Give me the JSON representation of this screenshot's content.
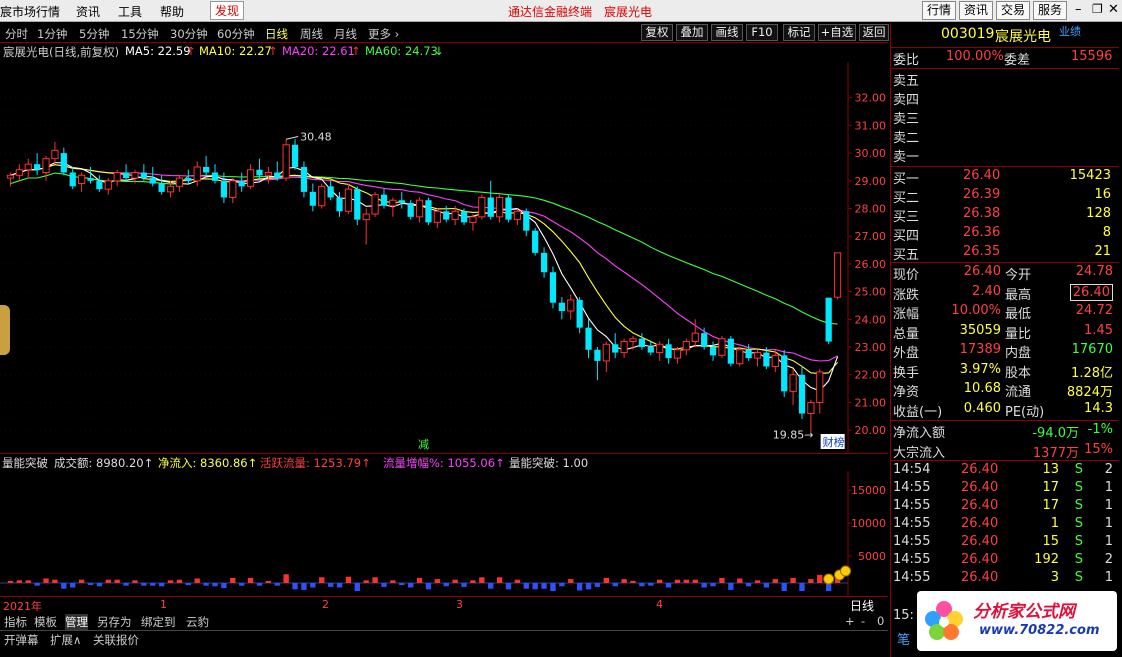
{
  "menubar": {
    "items": [
      "宸市场行情",
      "资讯",
      "工具",
      "帮助",
      "发现"
    ],
    "center_title": "通达信金融终端",
    "center_stock": "宸展光电",
    "right_buttons": [
      "行情",
      "资讯",
      "交易",
      "服务"
    ]
  },
  "toolbar": {
    "periods": [
      "分时",
      "1分钟",
      "5分钟",
      "15分钟",
      "30分钟",
      "60分钟",
      "日线",
      "周线",
      "月线",
      "更多 ›"
    ],
    "buttons": [
      "复权",
      "叠加",
      "画线",
      "F10",
      "标记",
      "+自选",
      "返回"
    ]
  },
  "main_chart": {
    "header": {
      "title": "宸展光电(日线,前复权)",
      "ma5": "MA5: 22.59",
      "ma10": "MA10: 22.27",
      "ma20": "MA20: 22.61",
      "ma60": "MA60: 24.73"
    },
    "high_label": "30.48",
    "low_label": "19.85→",
    "marker_jian": "减",
    "marker_cai": "财榜",
    "y_ticks": [
      "32.00",
      "31.00",
      "30.00",
      "29.00",
      "28.00",
      "27.00",
      "26.00",
      "25.00",
      "24.00",
      "23.00",
      "22.00",
      "21.00",
      "20.00"
    ]
  },
  "sub_chart": {
    "header": {
      "title": "量能突破",
      "chengjiao": "成交额: 8980.20↑",
      "jingliuru": "净流入: 8360.86↑",
      "huoyue": "活跃流量: 1253.79↑",
      "zengfu": "流量增幅%: 1055.06↑",
      "tupo": "量能突破: 1.00"
    },
    "y_ticks": [
      "15000",
      "10000",
      "5000"
    ]
  },
  "time_axis": {
    "labels": [
      "2021年",
      "1",
      "2",
      "3",
      "4"
    ],
    "period_label": "日线"
  },
  "bottom_tabs": {
    "row1": [
      "指标",
      "模板",
      "管理",
      "另存为",
      "绑定到",
      "云豹"
    ],
    "row2": [
      "开弹幕",
      "扩展∧",
      "关联报价"
    ],
    "controls": [
      "+",
      "-",
      "0"
    ]
  },
  "quote": {
    "code": "003019",
    "name": "宸展光电",
    "tag": "业绩",
    "weibi": {
      "label": "委比",
      "value": "100.00%"
    },
    "weicha": {
      "label": "委差",
      "value": "15596"
    },
    "sell": [
      {
        "label": "卖五"
      },
      {
        "label": "卖四"
      },
      {
        "label": "卖三"
      },
      {
        "label": "卖二"
      },
      {
        "label": "卖一"
      }
    ],
    "buy": [
      {
        "label": "买一",
        "price": "26.40",
        "vol": "15423"
      },
      {
        "label": "买二",
        "price": "26.39",
        "vol": "16"
      },
      {
        "label": "买三",
        "price": "26.38",
        "vol": "128"
      },
      {
        "label": "买四",
        "price": "26.36",
        "vol": "8"
      },
      {
        "label": "买五",
        "price": "26.35",
        "vol": "21"
      }
    ],
    "stats": [
      {
        "l1": "现价",
        "v1": "26.40",
        "l2": "今开",
        "v2": "24.78",
        "c1": "#ff4040",
        "c2": "#ff4040"
      },
      {
        "l1": "涨跌",
        "v1": "2.40",
        "l2": "最高",
        "v2": "26.40",
        "c1": "#ff4040",
        "c2": "#ff4040",
        "box2": true
      },
      {
        "l1": "涨幅",
        "v1": "10.00%",
        "l2": "最低",
        "v2": "24.72",
        "c1": "#ff4040",
        "c2": "#ff4040"
      },
      {
        "l1": "总量",
        "v1": "35059",
        "l2": "量比",
        "v2": "1.45",
        "c1": "#ffff40",
        "c2": "#ff4040"
      },
      {
        "l1": "外盘",
        "v1": "17389",
        "l2": "内盘",
        "v2": "17670",
        "c1": "#ff4040",
        "c2": "#40ff40"
      },
      {
        "l1": "换手",
        "v1": "3.97%",
        "l2": "股本",
        "v2": "1.28亿",
        "c1": "#ffff40",
        "c2": "#ffff40"
      },
      {
        "l1": "净资",
        "v1": "10.68",
        "l2": "流通",
        "v2": "8824万",
        "c1": "#ffff40",
        "c2": "#ffff40"
      },
      {
        "l1": "收益(一)",
        "v1": "0.460",
        "l2": "PE(动)",
        "v2": "14.3",
        "c1": "#ffff40",
        "c2": "#ffff40"
      }
    ],
    "flow": [
      {
        "label": "净流入额",
        "v1": "-94.0万",
        "v2": "-1%",
        "c": "#40ff40"
      },
      {
        "label": "大宗流入",
        "v1": "1377万",
        "v2": "15%",
        "c": "#ff4040"
      }
    ],
    "ticks": [
      {
        "time": "14:54",
        "price": "26.40",
        "vol": "13",
        "side": "S",
        "n": "2"
      },
      {
        "time": "14:55",
        "price": "26.40",
        "vol": "17",
        "side": "S",
        "n": "1"
      },
      {
        "time": "14:55",
        "price": "26.40",
        "vol": "17",
        "side": "S",
        "n": "1"
      },
      {
        "time": "14:55",
        "price": "26.40",
        "vol": "1",
        "side": "S",
        "n": "1"
      },
      {
        "time": "14:55",
        "price": "26.40",
        "vol": "15",
        "side": "S",
        "n": "1"
      },
      {
        "time": "14:55",
        "price": "26.40",
        "vol": "192",
        "side": "S",
        "n": "2"
      },
      {
        "time": "14:55",
        "price": "26.40",
        "vol": "3",
        "side": "S",
        "n": "1"
      }
    ],
    "more_left": "15:",
    "more_bottom": "笔"
  },
  "logo": {
    "text": "分析家公式网",
    "url": "www.70822.com"
  },
  "chart_data": {
    "type": "candlestick",
    "title": "宸展光电(日线,前复权)",
    "ylim": [
      19.5,
      33
    ],
    "candles": [
      [
        29.1,
        29.3,
        28.8,
        29.2
      ],
      [
        29.2,
        29.6,
        29.0,
        29.4
      ],
      [
        29.4,
        29.8,
        29.1,
        29.6
      ],
      [
        29.6,
        30.0,
        29.2,
        29.4
      ],
      [
        29.3,
        29.9,
        29.0,
        29.8
      ],
      [
        29.8,
        30.4,
        29.6,
        30.1
      ],
      [
        30.0,
        30.2,
        29.2,
        29.3
      ],
      [
        29.3,
        29.5,
        28.7,
        28.8
      ],
      [
        28.9,
        29.3,
        28.6,
        29.2
      ],
      [
        29.1,
        29.5,
        28.9,
        29.0
      ],
      [
        29.0,
        29.2,
        28.6,
        28.7
      ],
      [
        28.7,
        29.1,
        28.5,
        29.0
      ],
      [
        29.0,
        29.4,
        28.8,
        29.3
      ],
      [
        29.3,
        29.6,
        29.0,
        29.1
      ],
      [
        29.1,
        29.4,
        28.9,
        29.3
      ],
      [
        29.3,
        29.6,
        29.0,
        29.1
      ],
      [
        29.1,
        29.5,
        28.8,
        28.9
      ],
      [
        28.9,
        29.2,
        28.5,
        28.6
      ],
      [
        28.6,
        29.0,
        28.4,
        28.8
      ],
      [
        28.8,
        29.2,
        28.6,
        29.1
      ],
      [
        29.1,
        29.4,
        28.9,
        29.0
      ],
      [
        29.0,
        29.7,
        28.8,
        29.5
      ],
      [
        29.5,
        29.9,
        29.2,
        29.3
      ],
      [
        29.3,
        29.6,
        28.9,
        29.0
      ],
      [
        29.0,
        29.3,
        28.2,
        28.4
      ],
      [
        28.4,
        29.1,
        28.2,
        29.0
      ],
      [
        29.0,
        29.3,
        28.6,
        28.8
      ],
      [
        28.8,
        29.6,
        28.7,
        29.4
      ],
      [
        29.4,
        29.8,
        29.1,
        29.2
      ],
      [
        29.2,
        29.5,
        28.9,
        29.3
      ],
      [
        29.3,
        29.7,
        29.0,
        29.1
      ],
      [
        29.1,
        30.5,
        29.0,
        30.3
      ],
      [
        30.3,
        30.5,
        29.4,
        29.5
      ],
      [
        29.5,
        29.7,
        28.4,
        28.6
      ],
      [
        28.6,
        28.9,
        27.9,
        28.1
      ],
      [
        28.1,
        28.9,
        28.0,
        28.8
      ],
      [
        28.8,
        29.0,
        28.3,
        28.4
      ],
      [
        28.4,
        28.6,
        27.7,
        27.9
      ],
      [
        27.9,
        28.9,
        27.8,
        28.7
      ],
      [
        28.7,
        28.8,
        27.4,
        27.6
      ],
      [
        27.6,
        28.0,
        26.7,
        27.8
      ],
      [
        27.8,
        28.6,
        27.7,
        28.5
      ],
      [
        28.5,
        28.7,
        28.0,
        28.1
      ],
      [
        28.1,
        28.4,
        27.7,
        28.3
      ],
      [
        28.3,
        28.6,
        28.0,
        28.2
      ],
      [
        28.2,
        28.3,
        27.6,
        27.7
      ],
      [
        27.7,
        28.4,
        27.5,
        28.3
      ],
      [
        28.3,
        28.4,
        27.4,
        27.5
      ],
      [
        27.5,
        28.0,
        27.3,
        27.9
      ],
      [
        27.9,
        28.1,
        27.5,
        27.6
      ],
      [
        27.6,
        28.1,
        27.4,
        27.9
      ],
      [
        27.9,
        28.0,
        27.4,
        27.5
      ],
      [
        27.5,
        27.8,
        27.2,
        27.7
      ],
      [
        27.7,
        28.5,
        27.6,
        28.4
      ],
      [
        28.4,
        29.0,
        27.6,
        27.7
      ],
      [
        27.7,
        28.5,
        27.5,
        28.4
      ],
      [
        28.4,
        28.5,
        27.5,
        27.6
      ],
      [
        27.6,
        28.0,
        27.4,
        27.9
      ],
      [
        27.9,
        28.0,
        27.0,
        27.2
      ],
      [
        27.2,
        27.3,
        26.3,
        26.4
      ],
      [
        26.4,
        26.6,
        25.5,
        25.7
      ],
      [
        25.7,
        25.9,
        24.4,
        24.6
      ],
      [
        24.6,
        24.8,
        24.0,
        24.3
      ],
      [
        24.3,
        24.9,
        24.0,
        24.7
      ],
      [
        24.7,
        24.8,
        23.5,
        23.7
      ],
      [
        23.7,
        24.0,
        22.6,
        22.9
      ],
      [
        22.9,
        23.0,
        21.8,
        22.5
      ],
      [
        22.5,
        23.2,
        22.1,
        23.1
      ],
      [
        23.1,
        23.5,
        22.6,
        22.8
      ],
      [
        22.8,
        23.3,
        22.6,
        23.2
      ],
      [
        23.2,
        23.4,
        22.9,
        23.3
      ],
      [
        23.3,
        23.5,
        22.9,
        23.0
      ],
      [
        23.0,
        23.2,
        22.7,
        22.8
      ],
      [
        22.8,
        23.2,
        22.5,
        23.1
      ],
      [
        23.1,
        23.3,
        22.4,
        22.6
      ],
      [
        22.6,
        23.0,
        22.4,
        22.9
      ],
      [
        22.9,
        23.3,
        22.7,
        23.2
      ],
      [
        23.2,
        24.0,
        23.0,
        23.5
      ],
      [
        23.5,
        23.7,
        22.9,
        23.0
      ],
      [
        23.0,
        23.2,
        22.5,
        22.7
      ],
      [
        22.7,
        23.4,
        22.6,
        23.3
      ],
      [
        23.3,
        23.4,
        22.3,
        22.4
      ],
      [
        22.4,
        23.0,
        22.3,
        22.9
      ],
      [
        22.9,
        23.1,
        22.5,
        22.6
      ],
      [
        22.6,
        22.9,
        22.3,
        22.8
      ],
      [
        22.8,
        23.0,
        22.2,
        22.3
      ],
      [
        22.3,
        22.9,
        22.1,
        22.7
      ],
      [
        22.7,
        22.9,
        21.2,
        21.4
      ],
      [
        21.4,
        22.2,
        20.9,
        22.0
      ],
      [
        22.0,
        22.3,
        20.4,
        20.6
      ],
      [
        20.6,
        21.1,
        19.85,
        21.0
      ],
      [
        21.0,
        22.2,
        20.6,
        22.1
      ],
      [
        24.78,
        24.78,
        23.1,
        23.2
      ],
      [
        24.8,
        26.4,
        24.72,
        26.4
      ]
    ],
    "ma5_end": 22.59,
    "ma10_end": 22.27,
    "ma20_end": 22.61,
    "ma60_end": 24.73
  }
}
